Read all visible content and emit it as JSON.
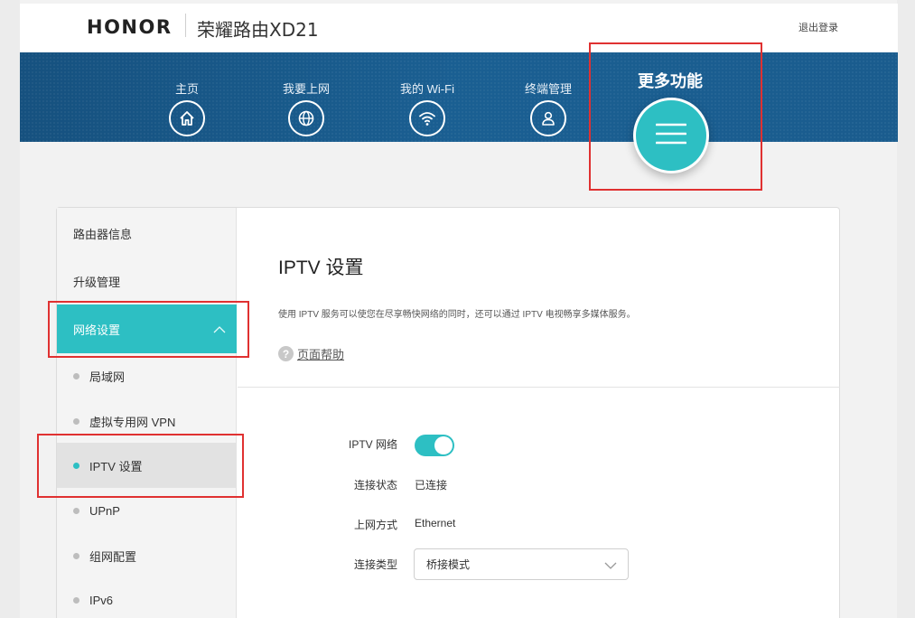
{
  "header": {
    "brand": "HONOR",
    "product_name": "荣耀路由XD21",
    "logout_label": "退出登录"
  },
  "nav": {
    "items": [
      {
        "label": "主页",
        "icon": "home-icon"
      },
      {
        "label": "我要上网",
        "icon": "globe-icon"
      },
      {
        "label": "我的 Wi-Fi",
        "icon": "wifi-icon"
      },
      {
        "label": "终端管理",
        "icon": "user-icon"
      }
    ],
    "more_label": "更多功能",
    "more_icon": "menu-icon"
  },
  "sidebar": {
    "top_items": [
      {
        "label": "路由器信息"
      },
      {
        "label": "升级管理"
      }
    ],
    "active_group": {
      "label": "网络设置",
      "icon": "chevron-up-icon"
    },
    "sub_items": [
      {
        "label": "局域网"
      },
      {
        "label": "虚拟专用网 VPN"
      },
      {
        "label": "IPTV 设置"
      },
      {
        "label": "UPnP"
      },
      {
        "label": "组网配置"
      },
      {
        "label": "IPv6"
      }
    ]
  },
  "content": {
    "title": "IPTV 设置",
    "description": "使用 IPTV 服务可以使您在尽享畅快网络的同时，还可以通过 IPTV 电视畅享多媒体服务。",
    "help_label": "页面帮助",
    "fields": {
      "iptv_network_label": "IPTV 网络",
      "iptv_network_enabled": true,
      "status_label": "连接状态",
      "status_value": "已连接",
      "wan_mode_label": "上网方式",
      "wan_mode_value": "Ethernet",
      "conn_type_label": "连接类型",
      "conn_type_value": "桥接模式"
    }
  },
  "colors": {
    "accent": "#2dbfc3",
    "banner": "#1a5a8c",
    "highlight": "#e03131"
  }
}
